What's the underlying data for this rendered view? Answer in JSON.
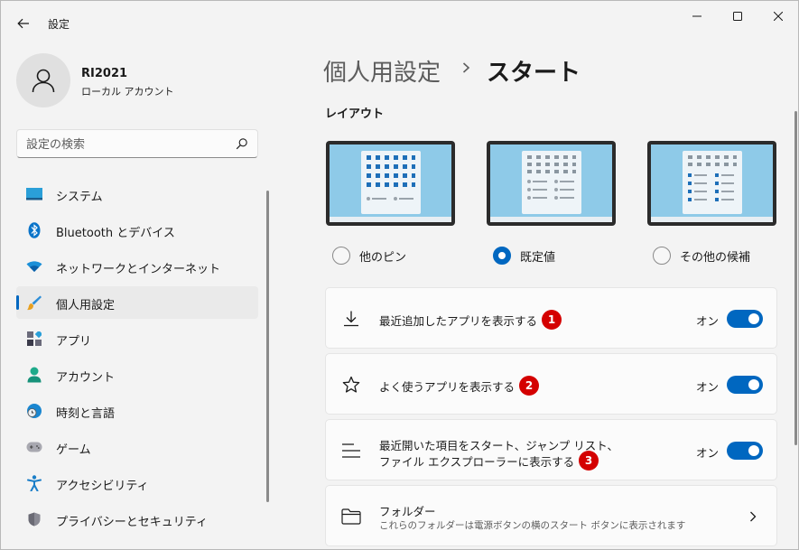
{
  "app": {
    "title": "設定"
  },
  "profile": {
    "name": "RI2021",
    "account_type": "ローカル アカウント"
  },
  "search": {
    "placeholder": "設定の検索"
  },
  "sidebar": {
    "items": [
      {
        "label": "システム",
        "icon": "system-icon",
        "active": false
      },
      {
        "label": "Bluetooth とデバイス",
        "icon": "bluetooth-icon",
        "active": false
      },
      {
        "label": "ネットワークとインターネット",
        "icon": "network-icon",
        "active": false
      },
      {
        "label": "個人用設定",
        "icon": "personalization-icon",
        "active": true
      },
      {
        "label": "アプリ",
        "icon": "apps-icon",
        "active": false
      },
      {
        "label": "アカウント",
        "icon": "account-icon",
        "active": false
      },
      {
        "label": "時刻と言語",
        "icon": "time-language-icon",
        "active": false
      },
      {
        "label": "ゲーム",
        "icon": "gaming-icon",
        "active": false
      },
      {
        "label": "アクセシビリティ",
        "icon": "accessibility-icon",
        "active": false
      },
      {
        "label": "プライバシーとセキュリティ",
        "icon": "privacy-icon",
        "active": false
      }
    ]
  },
  "breadcrumb": {
    "parent": "個人用設定",
    "current": "スタート"
  },
  "layout_section": {
    "title": "レイアウト",
    "options": [
      {
        "label": "他のピン",
        "selected": false
      },
      {
        "label": "既定値",
        "selected": true
      },
      {
        "label": "その他の候補",
        "selected": false
      }
    ]
  },
  "settings": [
    {
      "title": "最近追加したアプリを表示する",
      "marker": "1",
      "state": "オン",
      "on": true,
      "icon": "download-icon"
    },
    {
      "title": "よく使うアプリを表示する",
      "marker": "2",
      "state": "オン",
      "on": true,
      "icon": "star-icon"
    },
    {
      "title_line1": "最近開いた項目をスタート、ジャンプ リスト、",
      "title_line2": "ファイル エクスプローラーに表示する",
      "marker": "3",
      "state": "オン",
      "on": true,
      "icon": "list-icon"
    },
    {
      "title": "フォルダー",
      "subtitle": "これらのフォルダーは電源ボタンの横のスタート ボタンに表示されます",
      "icon": "folder-icon"
    }
  ],
  "colors": {
    "accent": "#0067c0",
    "marker": "#d40000",
    "background": "#f3f3f3",
    "card": "#fbfbfb"
  }
}
